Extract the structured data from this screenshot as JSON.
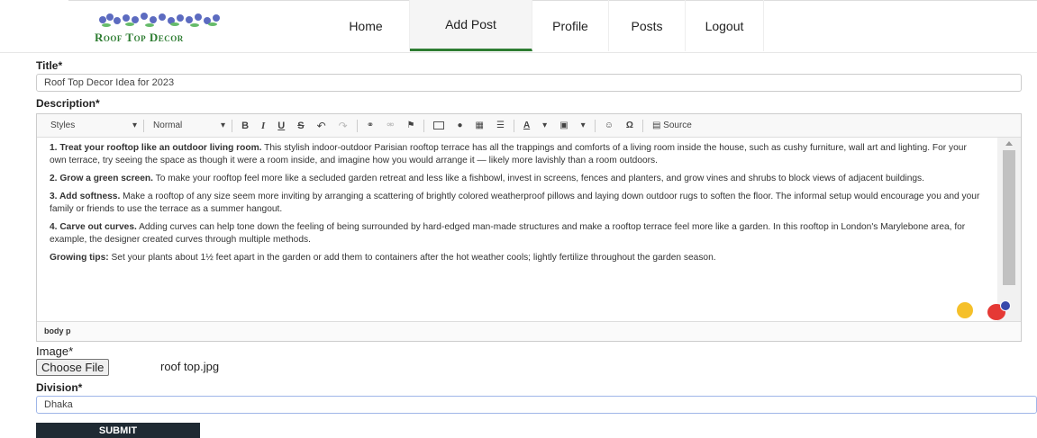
{
  "nav": {
    "logo_text": "Roof Top Decor",
    "items": [
      {
        "label": "Home",
        "active": false
      },
      {
        "label": "Add Post",
        "active": true
      },
      {
        "label": "Profile",
        "active": false
      },
      {
        "label": "Posts",
        "active": false
      },
      {
        "label": "Logout",
        "active": false
      }
    ]
  },
  "form": {
    "title_label": "Title*",
    "title_value": "Roof Top Decor Idea for 2023",
    "description_label": "Description*",
    "image_label": "Image*",
    "choose_file_label": "Choose File",
    "file_name": "roof top.jpg",
    "division_label": "Division*",
    "division_value": "Dhaka",
    "submit_label": "SUBMIT"
  },
  "editor": {
    "styles_label": "Styles",
    "format_label": "Normal",
    "bold": "B",
    "italic": "I",
    "underline": "U",
    "strike": "S",
    "source_label": "Source",
    "status_path": "body  p",
    "paragraphs": [
      {
        "bold": "1. Treat your rooftop like an outdoor living room.",
        "text": " This stylish indoor-outdoor Parisian rooftop terrace has all the trappings and comforts of a living room inside the house, such as cushy furniture, wall art and lighting. For your own terrace, try seeing the space as though it were a room inside, and imagine how you would arrange it — likely more lavishly than a room outdoors."
      },
      {
        "bold": "2. Grow a green screen.",
        "text": " To make your rooftop feel more like a secluded garden retreat and less like a fishbowl, invest in screens, fences and planters, and grow vines and shrubs to block views of adjacent buildings."
      },
      {
        "bold": "3. Add softness.",
        "text": " Make a rooftop of any size seem more inviting by arranging a scattering of brightly colored weatherproof pillows and laying down outdoor rugs to soften the floor. The informal setup would encourage you and your family or friends to use the terrace as a summer hangout."
      },
      {
        "bold": "4. Carve out curves.",
        "text": " Adding curves can help tone down the feeling of being surrounded by hard-edged man-made structures and make a rooftop terrace feel more like a garden. In this rooftop in London's Marylebone area, for example, the designer created curves through multiple methods."
      },
      {
        "bold": "Growing tips:",
        "text": " Set your plants about 1½ feet apart in the garden or add them to containers after the hot weather cools; lightly fertilize throughout the garden season."
      }
    ]
  },
  "colors": {
    "accent": "#2e7d32",
    "submit_bg": "#1f2a33"
  }
}
